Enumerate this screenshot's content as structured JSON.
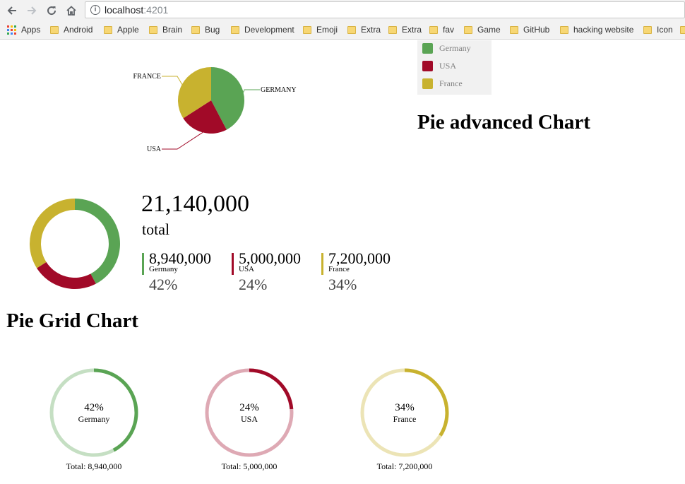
{
  "browser": {
    "url_host": "localhost",
    "url_port": ":4201",
    "bookmarks": [
      "Apps",
      "Android",
      "Apple",
      "Brain",
      "Bug",
      "Development",
      "Emoji",
      "Extra",
      "Extra",
      "fav",
      "Game",
      "GitHub",
      "hacking website",
      "Icon"
    ]
  },
  "colors": {
    "germany": "#5aa454",
    "usa": "#a10a28",
    "france": "#c8b22f"
  },
  "legend": [
    "Germany",
    "USA",
    "France"
  ],
  "pie_chart": {
    "labels": [
      "GERMANY",
      "USA",
      "FRANCE"
    ]
  },
  "advanced": {
    "title": "Pie advanced Chart",
    "total": "21,140,000",
    "total_label": "total",
    "items": [
      {
        "value": "8,940,000",
        "label": "Germany",
        "percent": "42%"
      },
      {
        "value": "5,000,000",
        "label": "USA",
        "percent": "24%"
      },
      {
        "value": "7,200,000",
        "label": "France",
        "percent": "34%"
      }
    ]
  },
  "grid": {
    "title": "Pie Grid Chart",
    "items": [
      {
        "percent": "42%",
        "name": "Germany",
        "total": "Total: 8,940,000"
      },
      {
        "percent": "24%",
        "name": "USA",
        "total": "Total: 5,000,000"
      },
      {
        "percent": "34%",
        "name": "France",
        "total": "Total: 7,200,000"
      }
    ]
  },
  "chart_data": {
    "type": "pie",
    "categories": [
      "Germany",
      "USA",
      "France"
    ],
    "values": [
      8940000,
      5000000,
      7200000
    ]
  }
}
